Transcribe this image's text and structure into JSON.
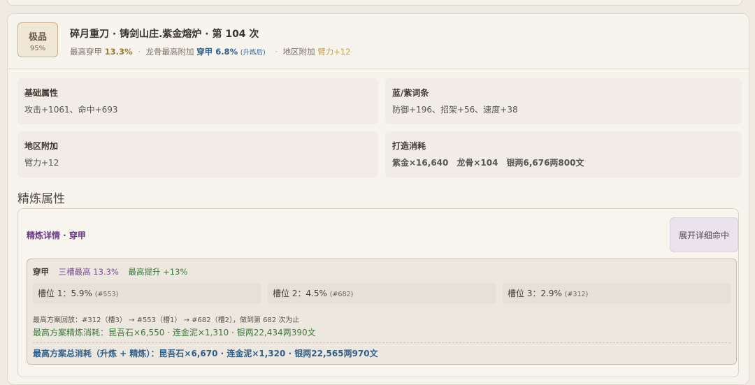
{
  "item": {
    "grade": "极品",
    "percent": "95%",
    "title": "碎月重刀 · 铸剑山庄.紫金熔炉 · 第 104 次",
    "meta": {
      "max_pierce_label": "最高穿甲",
      "max_pierce_value": "13.3%",
      "dragon_label": "龙骨最高附加",
      "dragon_stat": "穿甲 6.8%",
      "dragon_note": "(升炼后)",
      "region_label": "地区附加",
      "region_value": "臂力+12"
    }
  },
  "panels": {
    "base": {
      "title": "基础属性",
      "value": "攻击+1061、命中+693"
    },
    "affix": {
      "title": "蓝/紫词条",
      "value": "防御+196、招架+56、速度+38"
    },
    "region": {
      "title": "地区附加",
      "value": "臂力+12"
    },
    "cost": {
      "title": "打造消耗",
      "value": "紫金×16,640　龙骨×104　银两6,676两800文"
    }
  },
  "refine": {
    "section_title": "精炼属性",
    "header": "精炼详情 · 穿甲",
    "expand_button": "展开详细命中",
    "detail": {
      "stat": "穿甲",
      "tri_max": "三槽最高 13.3%",
      "max_gain": "最高提升 +13%",
      "slots": [
        {
          "label": "槽位 1：5.9%",
          "id": "(#553)"
        },
        {
          "label": "槽位 2：4.5%",
          "id": "(#682)"
        },
        {
          "label": "槽位 3：2.9%",
          "id": "(#312)"
        }
      ],
      "replay": "最高方案回放：#312（槽3） → #553（槽1） → #682（槽2），做到第 682 次为止",
      "refine_cost": "最高方案精炼消耗：昆吾石×6,550 · 连金泥×1,310 · 银两22,434两390文",
      "total_cost": "最高方案总消耗（升炼 + 精炼）：昆吾石×6,670 · 连金泥×1,320 · 银两22,565两970文"
    }
  }
}
